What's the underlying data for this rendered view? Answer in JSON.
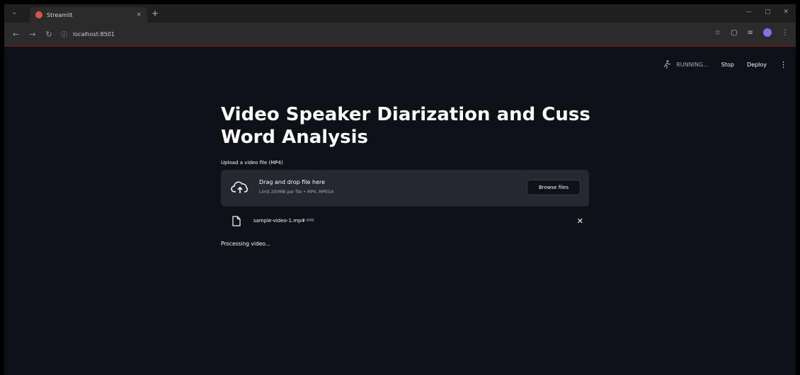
{
  "browser": {
    "tab_title": "Streamlit",
    "tab_close": "×",
    "new_tab": "+",
    "url": "localhost:8501",
    "window_controls": [
      "—",
      "▢",
      "✕"
    ]
  },
  "app_header": {
    "status": "RUNNING...",
    "stop_label": "Stop",
    "deploy_label": "Deploy",
    "menu_label": "⋮"
  },
  "main": {
    "title": "Video Speaker Diarization and Cuss Word Analysis",
    "upload_label": "Upload a video file (MP4)",
    "dropzone": {
      "title": "Drag and drop file here",
      "subtitle": "Limit 200MB per file • MP4, MPEG4",
      "browse_label": "Browse files"
    },
    "file": {
      "name": "sample-video-1.mp4",
      "size": "4.9MB",
      "remove": "✕"
    },
    "status_text": "Processing video..."
  },
  "colors": {
    "background": "#0e1117",
    "dropzone": "#262730",
    "text": "#fafafa",
    "muted": "#a3a8b8"
  }
}
